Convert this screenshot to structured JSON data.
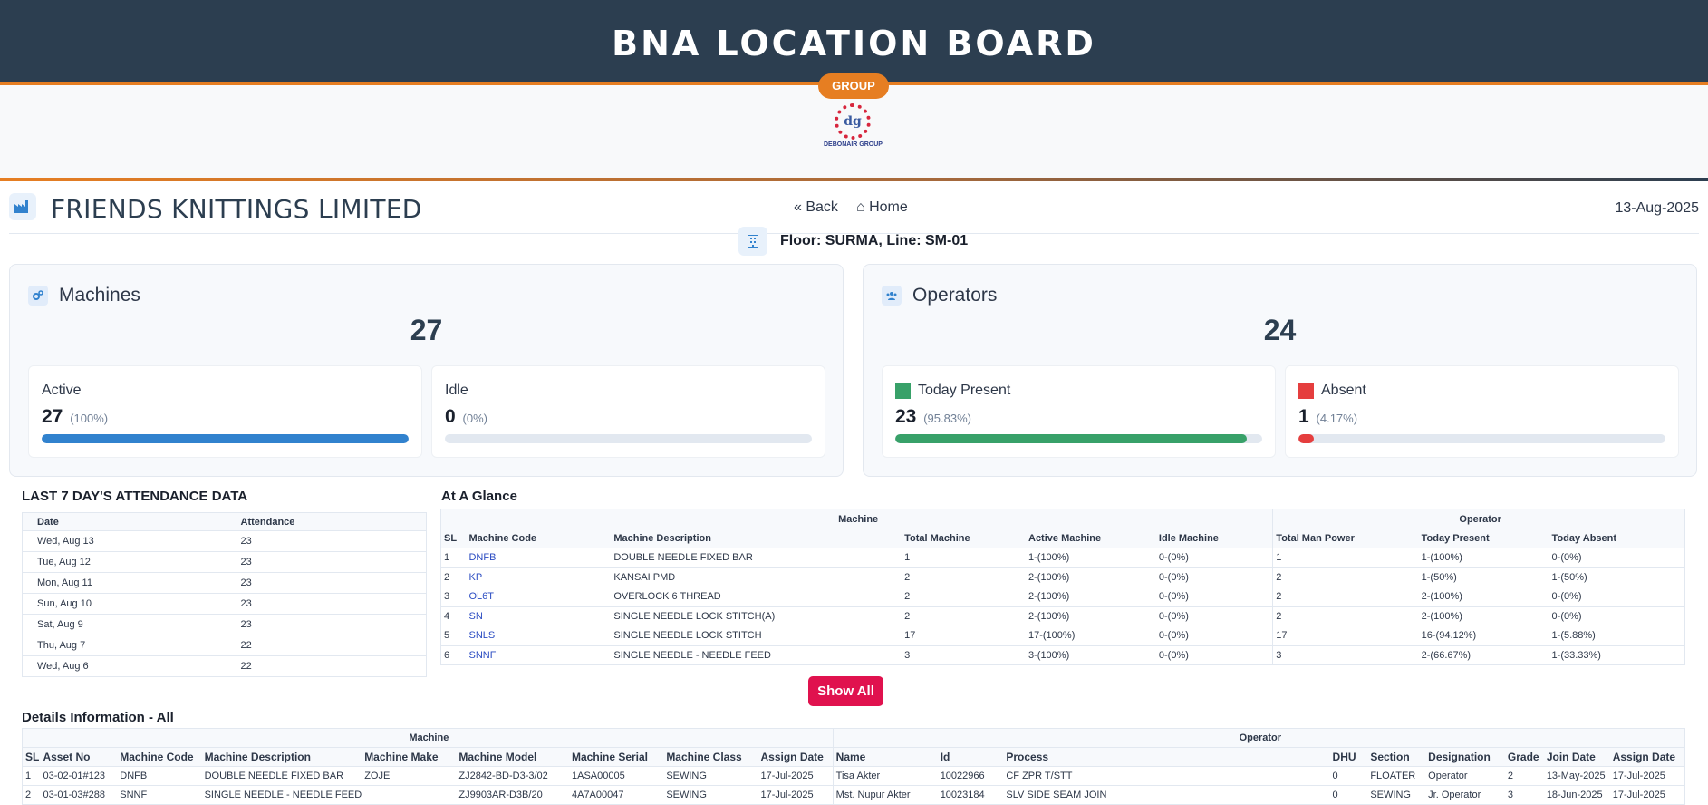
{
  "header": {
    "title": "BNA LOCATION BOARD",
    "pill": "GROUP",
    "logo_text": "DEBONAIR GROUP",
    "logo_mark": "dg"
  },
  "company": {
    "name": "FRIENDS KNITTINGS LIMITED",
    "back_label": "Back",
    "home_label": "Home",
    "date": "13-Aug-2025",
    "floor_line": "Floor: SURMA, Line: SM-01"
  },
  "machines": {
    "title": "Machines",
    "total": "27",
    "active": {
      "label": "Active",
      "value": "27",
      "pct": "(100%)",
      "fraction": 1.0,
      "color": "#3182ce"
    },
    "idle": {
      "label": "Idle",
      "value": "0",
      "pct": "(0%)",
      "fraction": 0.0,
      "color": "#a0aec0"
    }
  },
  "operators": {
    "title": "Operators",
    "total": "24",
    "present": {
      "label": "Today Present",
      "value": "23",
      "pct": "(95.83%)",
      "fraction": 0.9583,
      "color": "#38a169"
    },
    "absent": {
      "label": "Absent",
      "value": "1",
      "pct": "(4.17%)",
      "fraction": 0.0417,
      "color": "#e53e3e"
    }
  },
  "attendance": {
    "title": "LAST 7 DAY'S ATTENDANCE DATA",
    "headers": [
      "Date",
      "Attendance"
    ],
    "rows": [
      [
        "Wed, Aug 13",
        "23"
      ],
      [
        "Tue, Aug 12",
        "23"
      ],
      [
        "Mon, Aug 11",
        "23"
      ],
      [
        "Sun, Aug 10",
        "23"
      ],
      [
        "Sat, Aug 9",
        "23"
      ],
      [
        "Thu, Aug 7",
        "22"
      ],
      [
        "Wed, Aug 6",
        "22"
      ]
    ]
  },
  "glance": {
    "title": "At A Glance",
    "group_machine": "Machine",
    "group_operator": "Operator",
    "headers": [
      "SL",
      "Machine Code",
      "Machine Description",
      "Total Machine",
      "Active Machine",
      "Idle Machine",
      "Total Man Power",
      "Today Present",
      "Today Absent"
    ],
    "rows": [
      [
        "1",
        "DNFB",
        "DOUBLE NEEDLE FIXED BAR",
        "1",
        "1-(100%)",
        "0-(0%)",
        "1",
        "1-(100%)",
        "0-(0%)"
      ],
      [
        "2",
        "KP",
        "KANSAI PMD",
        "2",
        "2-(100%)",
        "0-(0%)",
        "2",
        "1-(50%)",
        "1-(50%)"
      ],
      [
        "3",
        "OL6T",
        "OVERLOCK 6 THREAD",
        "2",
        "2-(100%)",
        "0-(0%)",
        "2",
        "2-(100%)",
        "0-(0%)"
      ],
      [
        "4",
        "SN",
        "SINGLE NEEDLE LOCK STITCH(A)",
        "2",
        "2-(100%)",
        "0-(0%)",
        "2",
        "2-(100%)",
        "0-(0%)"
      ],
      [
        "5",
        "SNLS",
        "SINGLE NEEDLE LOCK STITCH",
        "17",
        "17-(100%)",
        "0-(0%)",
        "17",
        "16-(94.12%)",
        "1-(5.88%)"
      ],
      [
        "6",
        "SNNF",
        "SINGLE NEEDLE - NEEDLE FEED",
        "3",
        "3-(100%)",
        "0-(0%)",
        "3",
        "2-(66.67%)",
        "1-(33.33%)"
      ]
    ],
    "show_all": "Show All"
  },
  "details": {
    "title": "Details Information - All",
    "group_machine": "Machine",
    "group_operator": "Operator",
    "headers": [
      "SL",
      "Asset No",
      "Machine Code",
      "Machine Description",
      "Machine Make",
      "Machine Model",
      "Machine Serial",
      "Machine Class",
      "Assign Date",
      "Name",
      "Id",
      "Process",
      "DHU",
      "Section",
      "Designation",
      "Grade",
      "Join Date",
      "Assign Date"
    ],
    "rows": [
      [
        "1",
        "03-02-01#123",
        "DNFB",
        "DOUBLE NEEDLE FIXED BAR",
        "ZOJE",
        "ZJ2842-BD-D3-3/02",
        "1ASA00005",
        "SEWING",
        "17-Jul-2025",
        "Tisa Akter",
        "10022966",
        "CF ZPR T/STT",
        "0",
        "FLOATER",
        "Operator",
        "2",
        "13-May-2025",
        "17-Jul-2025"
      ],
      [
        "2",
        "03-01-03#288",
        "SNNF",
        "SINGLE NEEDLE - NEEDLE FEED",
        "",
        "ZJ9903AR-D3B/20",
        "4A7A00047",
        "SEWING",
        "17-Jul-2025",
        "Mst. Nupur Akter",
        "10023184",
        "SLV SIDE SEAM JOIN",
        "0",
        "SEWING",
        "Jr. Operator",
        "3",
        "18-Jun-2025",
        "17-Jul-2025"
      ]
    ]
  }
}
